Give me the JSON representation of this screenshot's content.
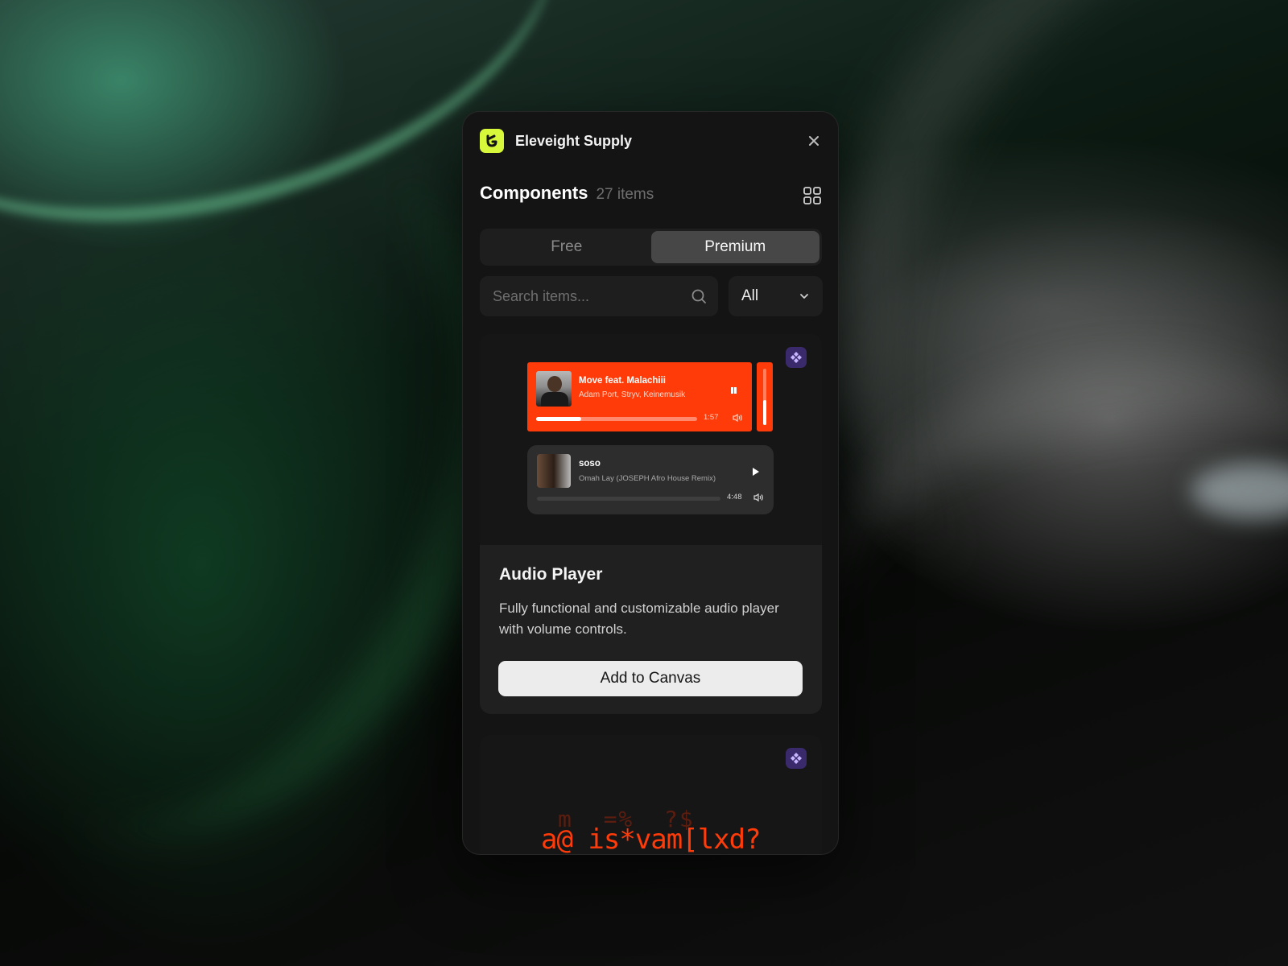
{
  "window": {
    "app_title": "Eleveight Supply"
  },
  "header": {
    "title": "Components",
    "count": "27 items"
  },
  "tabs": [
    {
      "label": "Free",
      "active": false
    },
    {
      "label": "Premium",
      "active": true
    }
  ],
  "search": {
    "placeholder": "Search items..."
  },
  "filter": {
    "selected": "All"
  },
  "cards": [
    {
      "title": "Audio Player",
      "description": "Fully functional and customizable audio player with volume controls.",
      "button_label": "Add to Canvas",
      "badge_icon": "figma-icon",
      "preview": {
        "players": [
          {
            "title": "Move feat. Malachiii",
            "artist": "Adam Port, Stryv, Keinemusik",
            "time": "1:57",
            "state": "playing",
            "progress": 0.28,
            "accent": "#ff3b0a"
          },
          {
            "title": "soso",
            "artist": "Omah Lay (JOSEPH Afro House Remix)",
            "time": "4:48",
            "state": "paused",
            "progress": 0.0
          }
        ],
        "volume_level": 0.45
      }
    },
    {
      "badge_icon": "figma-icon",
      "preview": {
        "glyphs_top": "m  =%  ?$",
        "glyphs_main": "a@ is*vam[lxd?"
      }
    }
  ],
  "colors": {
    "accent": "#ff3b0a",
    "logo": "#d7f73a",
    "panel": "#141414",
    "figma_badge": "#3b2a6b"
  }
}
